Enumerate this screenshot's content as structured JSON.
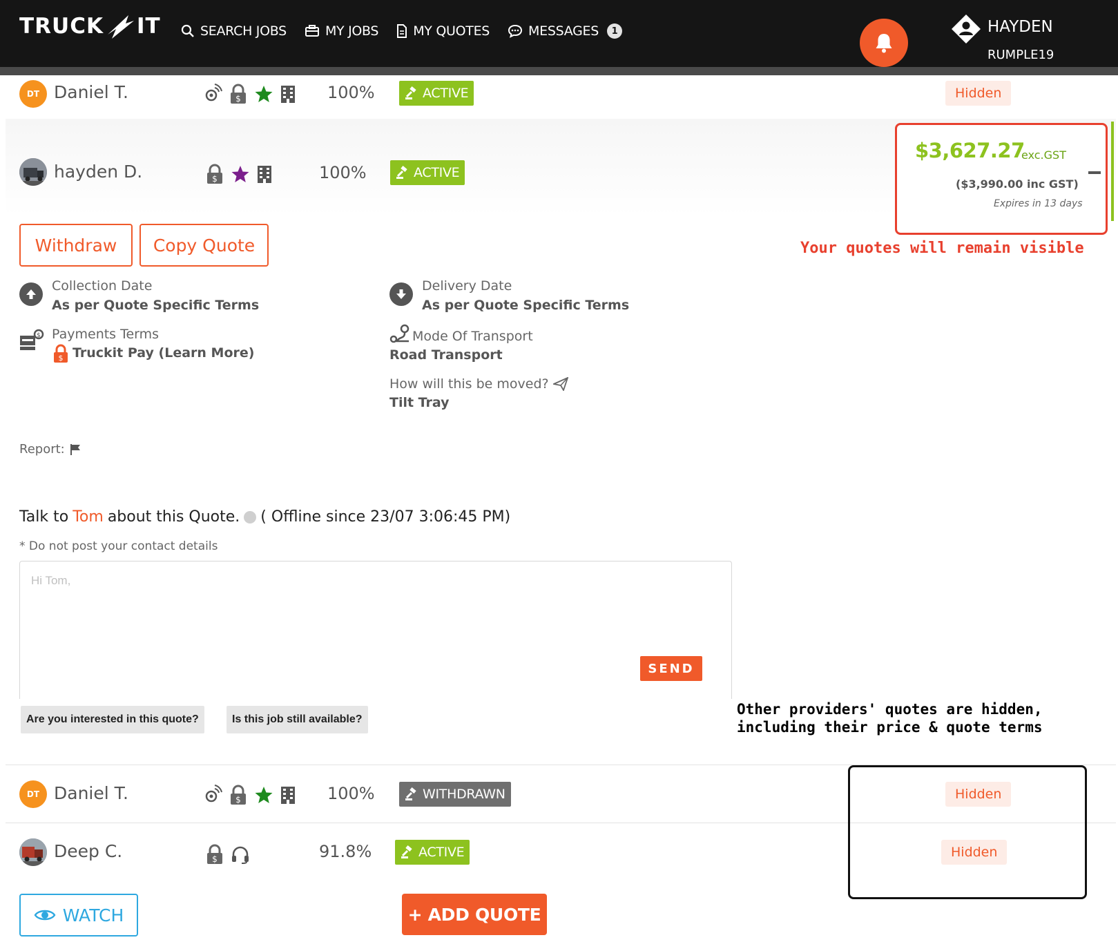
{
  "brand": {
    "logo_left": "TRUCK",
    "logo_right": "IT"
  },
  "nav": {
    "search_jobs": "SEARCH JOBS",
    "my_jobs": "MY JOBS",
    "my_quotes": "MY QUOTES",
    "messages": "MESSAGES",
    "messages_count": "1"
  },
  "user": {
    "name": "HAYDEN",
    "handle": "RUMPLE19"
  },
  "quotes": [
    {
      "initials": "DT",
      "name": "Daniel T.",
      "score": "100%",
      "status": "ACTIVE",
      "price_label": "Hidden"
    },
    {
      "name": "hayden D.",
      "score": "100%",
      "status": "ACTIVE"
    },
    {
      "initials": "DT",
      "name": "Daniel T.",
      "score": "100%",
      "status": "WITHDRAWN",
      "price_label": "Hidden"
    },
    {
      "name": "Deep C.",
      "score": "91.8%",
      "status": "ACTIVE",
      "price_label": "Hidden"
    }
  ],
  "own_quote": {
    "price": "$3,627.27",
    "ex_gst": "exc.GST",
    "inc_gst": "($3,990.00 inc GST)",
    "expires": "Expires in 13 days",
    "withdraw_label": "Withdraw",
    "copy_label": "Copy Quote",
    "collection_label": "Collection Date",
    "collection_value": "As per Quote Specific Terms",
    "delivery_label": "Delivery Date",
    "delivery_value": "As per Quote Specific Terms",
    "payment_label": "Payments Terms",
    "payment_value": "Truckit Pay (Learn More)",
    "transport_label": "Mode Of Transport",
    "transport_value": "Road Transport",
    "moved_label": "How will this be moved?",
    "moved_value": "Tilt Tray",
    "report_label": "Report:"
  },
  "chat": {
    "talk_prefix": "Talk to",
    "contact": "Tom",
    "talk_suffix": "about this Quote.",
    "offline": "( Offline since 23/07 3:06:45 PM)",
    "note": "* Do not post your contact details",
    "placeholder": "Hi Tom,",
    "send_label": "SEND",
    "quick_1": "Are you interested in this quote?",
    "quick_2": "Is this job still available?"
  },
  "annotations": {
    "visible_note": "Your quotes will remain visible",
    "hidden_note_line1": "Other providers' quotes are hidden,",
    "hidden_note_line2": "including their price & quote terms"
  },
  "actions": {
    "watch_label": "WATCH",
    "add_quote_label": "+ ADD QUOTE"
  },
  "colors": {
    "brand_orange": "#f05a2a",
    "active_green": "#8dc21f",
    "withdrawn_grey": "#6f6f6f",
    "watch_blue": "#2ea8e0",
    "annotation_red": "#e8402e"
  },
  "icons": [
    "search-icon",
    "briefcase-icon",
    "document-icon",
    "chat-icon",
    "bell-icon",
    "user-icon",
    "location-icon",
    "lock-dollar-icon",
    "star-icon",
    "building-icon",
    "gavel-icon",
    "headset-icon",
    "arrow-up-icon",
    "arrow-down-icon",
    "truck-cash-icon",
    "route-icon",
    "send-icon",
    "flag-icon",
    "eye-icon",
    "minus-icon"
  ]
}
